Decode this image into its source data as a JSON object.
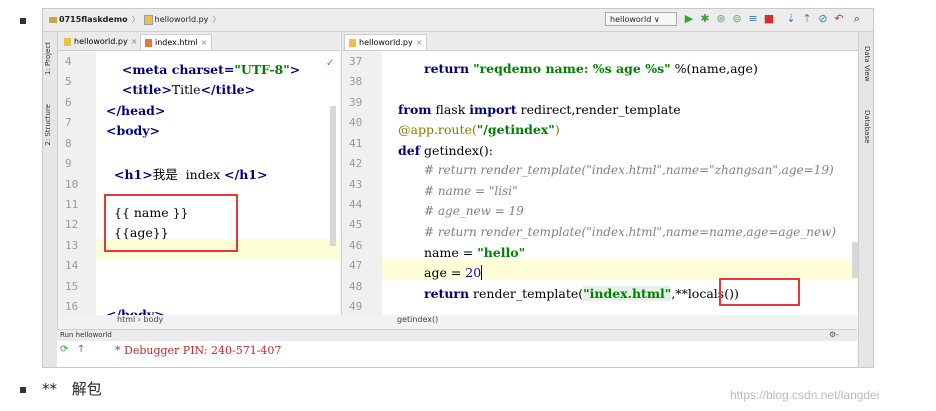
{
  "breadcrumb": {
    "project": "0715flaskdemo",
    "file": "helloworld.py"
  },
  "toolbar": {
    "run_config": "helloworld ∨"
  },
  "left_sidebar": {
    "project_tab": "1: Project",
    "structure_tab": "2: Structure"
  },
  "right_sidebar": {
    "data_view_tab": "Data View",
    "database_tab": "Database"
  },
  "left_pane": {
    "tabs": [
      {
        "label": "helloworld.py"
      },
      {
        "label": "index.html"
      }
    ],
    "line_numbers": [
      "4",
      "5",
      "6",
      "7",
      "8",
      "9",
      "10",
      "11",
      "12",
      "13",
      "14",
      "15",
      "16"
    ],
    "lines": [
      {
        "pre": "<meta charset=",
        "str": "\"UTF-8\"",
        "post": ">"
      },
      {
        "pre": "<title>",
        "text": "Title",
        "post": "</title>"
      },
      {
        "tag": "</head>"
      },
      {
        "tag": "<body>"
      },
      {
        "text": ""
      },
      {
        "pre": "<h1>",
        "text": "我是  index ",
        "post": "</h1>"
      },
      {
        "text": ""
      },
      {
        "text": "{{ name }}"
      },
      {
        "text": "{{age}}"
      },
      {
        "text": ""
      },
      {
        "text": ""
      },
      {
        "text": ""
      },
      {
        "tag": "</body>"
      }
    ],
    "status_path": "html  ›  body"
  },
  "right_pane": {
    "tabs": [
      {
        "label": "helloworld.py"
      }
    ],
    "line_numbers": [
      "37",
      "38",
      "39",
      "40",
      "41",
      "42",
      "43",
      "44",
      "45",
      "46",
      "47",
      "48",
      "49"
    ],
    "line37": {
      "kw": "return",
      "str": "\"reqdemo name: %s age %s\"",
      "rest": " %(name,age)"
    },
    "line39": {
      "kw1": "from",
      "mod": " flask ",
      "kw2": "import",
      "rest": " redirect,render_template"
    },
    "line40": {
      "dec": "@app.route(",
      "str": "\"/getindex\"",
      "post": ")"
    },
    "line41": {
      "kw": "def",
      "rest": " getindex():"
    },
    "line42": "# return render_template(\"index.html\",name=\"zhangsan\",age=19)",
    "line43": "# name = \"lisi\"",
    "line44": "# age_new = 19",
    "line45": "# return render_template(\"index.html\",name=name,age=age_new)",
    "line46": {
      "pre": "name = ",
      "str": "\"hello\""
    },
    "line47": {
      "pre": "age = ",
      "num": "20"
    },
    "line48": {
      "kw": "return",
      "pre": " render_template(",
      "str": "\"index.html\"",
      "comma": ",",
      "boxed": "**locals())"
    },
    "status_path": "getindex()"
  },
  "run_panel": {
    "header": "Run  helloworld",
    "output": "* Debugger PIN: 240-571-407"
  },
  "caption": {
    "stars": "**",
    "text": "解包"
  },
  "watermark": "https://blog.csdn.net/langdei"
}
